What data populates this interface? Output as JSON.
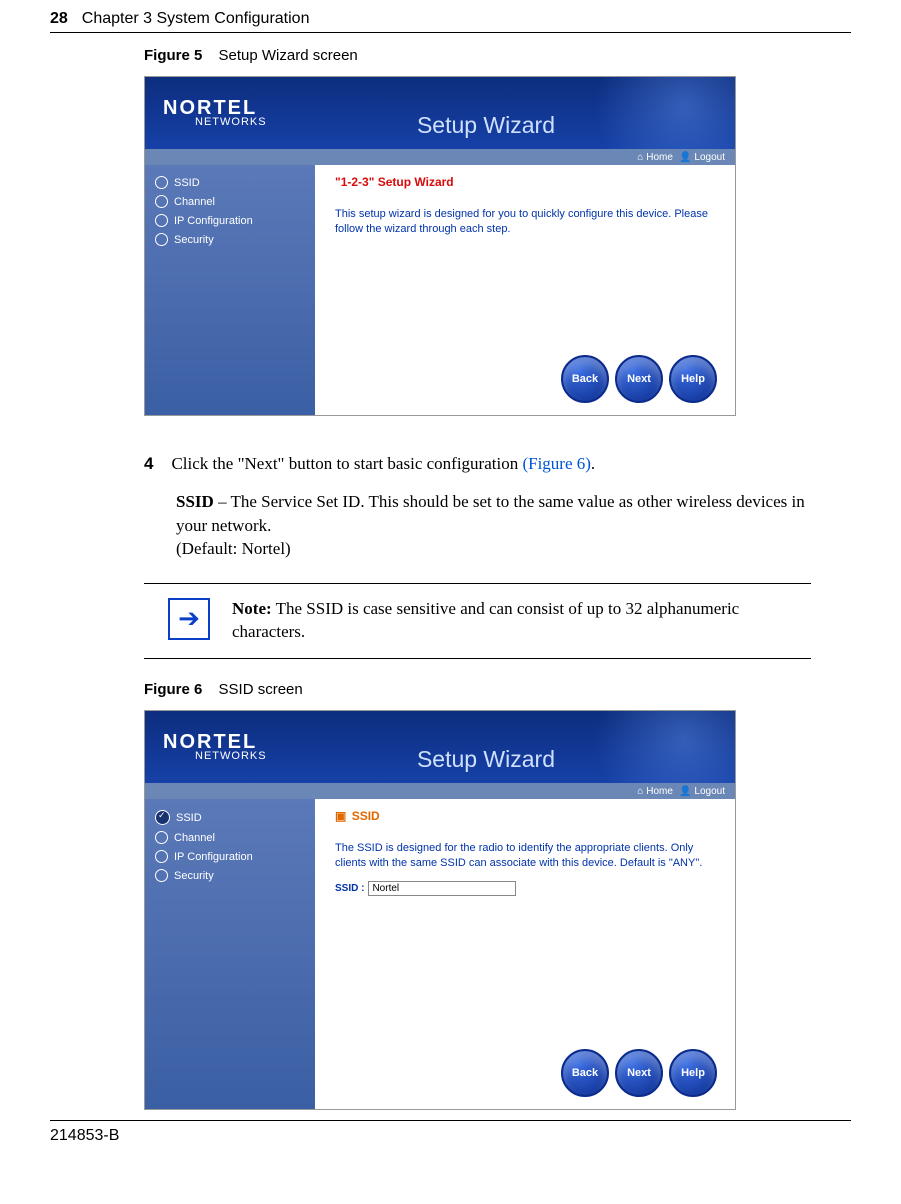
{
  "header": {
    "page_num": "28",
    "chapter": "Chapter 3  System Configuration"
  },
  "figure5": {
    "caption_label": "Figure 5",
    "caption_text": "Setup Wizard screen",
    "logo_line1": "NORTEL",
    "logo_line2": "NETWORKS",
    "wizard_title": "Setup Wizard",
    "topbar_home": "Home",
    "topbar_logout": "Logout",
    "sidebar": {
      "items": [
        {
          "label": "SSID"
        },
        {
          "label": "Channel"
        },
        {
          "label": "IP Configuration"
        },
        {
          "label": "Security"
        }
      ]
    },
    "content_heading": "\"1-2-3\" Setup Wizard",
    "content_text": "This setup wizard is designed for you to quickly configure this device. Please follow the wizard through each step.",
    "btn_back": "Back",
    "btn_next": "Next",
    "btn_help": "Help"
  },
  "step4": {
    "num": "4",
    "text_a": "Click the \"Next\" button to start basic configuration ",
    "text_link": "(Figure 6)",
    "text_b": "."
  },
  "ssid_para": {
    "bold": "SSID",
    "rest": " – The Service Set ID. This should be set to the same value as other wireless devices in your network.",
    "default": "(Default: Nortel)"
  },
  "note": {
    "bold": "Note:",
    "text": " The SSID is case sensitive and can consist of up to 32 alphanumeric characters."
  },
  "figure6": {
    "caption_label": "Figure 6",
    "caption_text": "SSID screen",
    "logo_line1": "NORTEL",
    "logo_line2": "NETWORKS",
    "wizard_title": "Setup Wizard",
    "topbar_home": "Home",
    "topbar_logout": "Logout",
    "sidebar": {
      "items": [
        {
          "label": "SSID"
        },
        {
          "label": "Channel"
        },
        {
          "label": "IP Configuration"
        },
        {
          "label": "Security"
        }
      ]
    },
    "content_heading": "SSID",
    "content_text": "The SSID is designed for the radio to identify the appropriate clients. Only clients with the same SSID can associate with this device. Default is \"ANY\".",
    "ssid_label": "SSID :",
    "ssid_value": "Nortel",
    "btn_back": "Back",
    "btn_next": "Next",
    "btn_help": "Help"
  },
  "footer": {
    "doc_id": "214853-B"
  }
}
